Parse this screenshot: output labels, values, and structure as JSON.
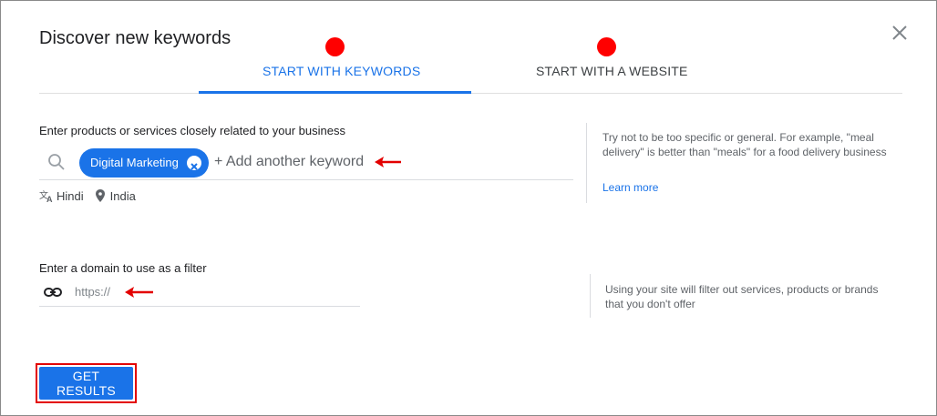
{
  "dialog": {
    "title": "Discover new keywords",
    "close_icon": "close-icon"
  },
  "tabs": [
    {
      "label": "START WITH KEYWORDS",
      "active": true
    },
    {
      "label": "START WITH A WEBSITE",
      "active": false
    }
  ],
  "keywords": {
    "label": "Enter products or services closely related to your business",
    "chip": "Digital Marketing",
    "placeholder": "+ Add another keyword",
    "language": "Hindi",
    "location": "India",
    "help": "Try not to be too specific or general. For example, \"meal delivery\" is better than \"meals\" for a food delivery business",
    "learn_more": "Learn more"
  },
  "domain": {
    "label": "Enter a domain to use as a filter",
    "placeholder": "https://",
    "help": "Using your site will filter out services, products or brands that you don't offer"
  },
  "actions": {
    "get_results": "GET RESULTS"
  },
  "colors": {
    "accent": "#1a73e8",
    "annotation": "#ff0000"
  }
}
